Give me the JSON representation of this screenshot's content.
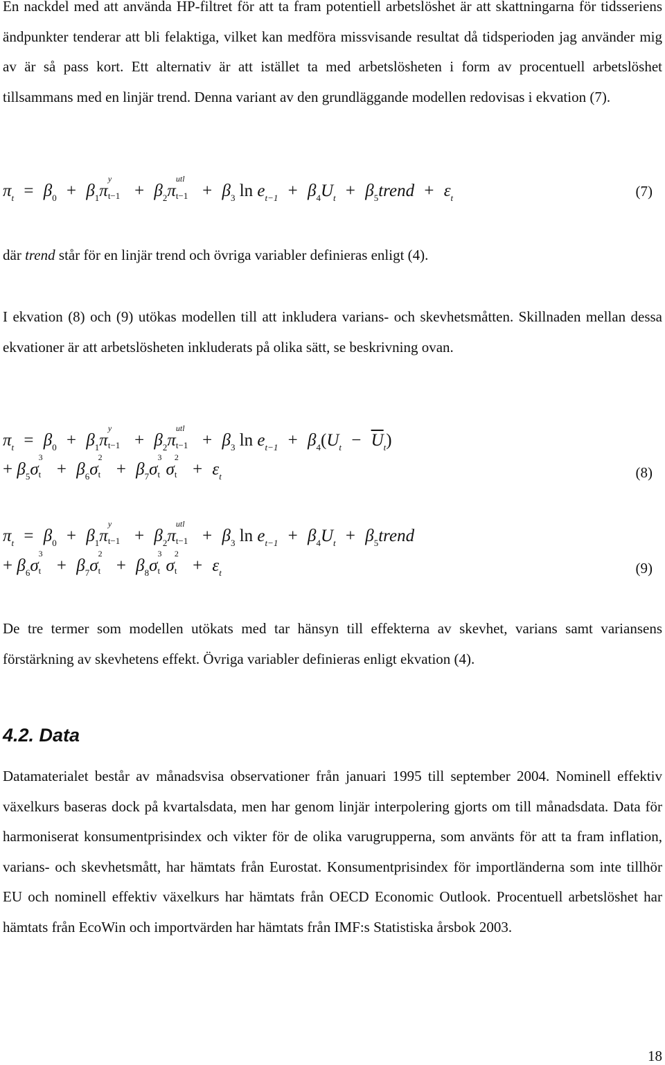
{
  "paragraphs": {
    "p1": "En nackdel med att använda HP-filtret för att ta fram potentiell arbetslöshet är att skattningarna för tidsseriens ändpunkter tenderar att bli felaktiga, vilket kan medföra missvisande resultat då tidsperioden jag använder mig av är så pass kort. Ett alternativ är att istället ta med arbetslösheten i form av procentuell arbetslöshet tillsammans med en linjär trend. Denna variant av den grundläggande modellen redovisas i ekvation (7).",
    "p2_prefix": "där ",
    "p2_italic": "trend",
    "p2_suffix": " står för en linjär trend och övriga variabler definieras enligt (4).",
    "p3": "I ekvation (8) och (9) utökas modellen till att inkludera varians- och skevhetsmåtten. Skillnaden mellan dessa ekvationer är att arbetslösheten inkluderats på olika sätt, se beskrivning ovan.",
    "p4": "De tre termer som modellen utökats med tar hänsyn till effekterna av skevhet, varians samt variansens förstärkning av skevhetens effekt. Övriga variabler definieras enligt ekvation (4).",
    "p5": "Datamaterialet består av månadsvisa observationer från januari 1995 till september 2004. Nominell effektiv växelkurs baseras dock på kvartalsdata, men har genom linjär interpolering gjorts om till månadsdata. Data för harmoniserat konsumentprisindex och vikter för de olika varugrupperna, som använts för att ta fram inflation, varians- och skevhetsmått, har hämtats från Eurostat. Konsumentprisindex för importländerna som inte tillhör EU och nominell effektiv växelkurs har hämtats från OECD Economic Outlook. Procentuell arbetslöshet har hämtats från EcoWin och importvärden har hämtats från IMF:s Statistiska årsbok 2003."
  },
  "equations": {
    "eq7_number": "(7)",
    "eq8_number": "(8)",
    "eq9_number": "(9)",
    "symbols": {
      "pi": "π",
      "beta": "β",
      "sigma": "σ",
      "epsilon": "ε",
      "eq": "=",
      "plus": "+",
      "minus": "−",
      "ln": "ln",
      "e": "e",
      "U": "U",
      "trend": "trend",
      "t": "t",
      "tm1": "t−1",
      "y": "y",
      "utl": "utl",
      "b0": "0",
      "b1": "1",
      "b2": "2",
      "b3": "3",
      "b4": "4",
      "b5": "5",
      "b6": "6",
      "b7": "7",
      "b8": "8",
      "sq": "2",
      "cube": "3",
      "lparen": "(",
      "rparen": ")"
    }
  },
  "section_heading": "4.2. Data",
  "page_number": "18"
}
